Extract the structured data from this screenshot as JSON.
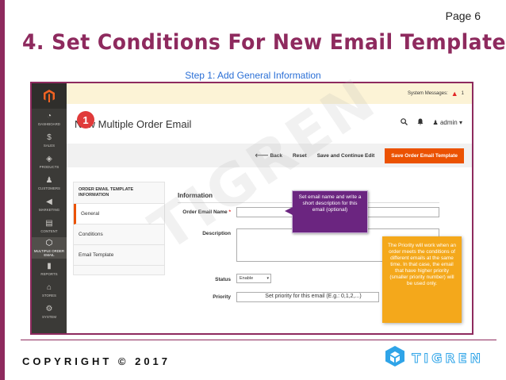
{
  "slide": {
    "page_label": "Page 6",
    "title": "4. Set Conditions For New Email Template",
    "step_caption": "Step 1: Add General Information",
    "copyright": "COPYRIGHT © 2017",
    "brand_name": "TIGREN",
    "accent_color": "#8e2a5e"
  },
  "screenshot": {
    "system_messages_label": "System Messages:",
    "system_messages_count": "1",
    "page_title": "New Multiple Order Email",
    "user_label": "admin",
    "watermark": "TIGREN",
    "sidebar": [
      {
        "label": "DASHBOARD",
        "icon": "dashboard-icon"
      },
      {
        "label": "SALES",
        "icon": "dollar-icon"
      },
      {
        "label": "PRODUCTS",
        "icon": "cube-icon"
      },
      {
        "label": "CUSTOMERS",
        "icon": "person-icon"
      },
      {
        "label": "MARKETING",
        "icon": "megaphone-icon"
      },
      {
        "label": "CONTENT",
        "icon": "content-icon"
      },
      {
        "label": "MULTIPLE ORDER EMAIL",
        "icon": "hexagon-icon"
      },
      {
        "label": "REPORTS",
        "icon": "bar-chart-icon"
      },
      {
        "label": "STORES",
        "icon": "store-icon"
      },
      {
        "label": "SYSTEM",
        "icon": "gear-icon"
      }
    ],
    "actions": {
      "back": "Back",
      "reset": "Reset",
      "save_continue": "Save and Continue Edit",
      "save_template": "Save Order Email Template"
    },
    "tabs_title": "ORDER EMAIL TEMPLATE INFORMATION",
    "tabs": [
      "General",
      "Conditions",
      "Email Template"
    ],
    "step_badge": "1",
    "form": {
      "section_title": "Information",
      "email_name_label": "Order Email Name",
      "description_label": "Description",
      "status_label": "Status",
      "status_value": "Enable",
      "priority_label": "Priority",
      "priority_hint": "Set priority for this email (E.g.: 0,1,2,...)"
    },
    "callouts": {
      "name_tip": "Set email name and write a short description for this email (optional)",
      "priority_tip": "The Priority will work when an order meets the conditions of different emails at the same time. In that case, the email that have higher priority (smaller priority number) will be used only."
    }
  }
}
